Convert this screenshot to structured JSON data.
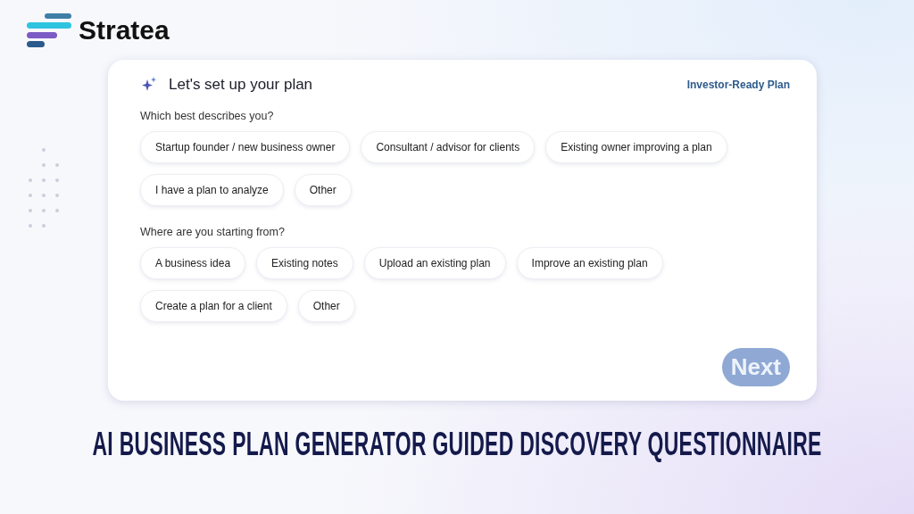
{
  "brand": {
    "name": "Stratea"
  },
  "card": {
    "title": "Let's set up your plan",
    "badge": "Investor-Ready Plan",
    "questions": [
      {
        "label": "Which best describes you?",
        "options": [
          {
            "label": "Startup founder / new business owner",
            "selected": false
          },
          {
            "label": "Consultant / advisor for clients",
            "selected": false
          },
          {
            "label": "Existing owner improving a plan",
            "selected": false
          },
          {
            "label": "I have a plan to analyze",
            "selected": false
          },
          {
            "label": "Other",
            "selected": false
          }
        ]
      },
      {
        "label": "Where are you starting from?",
        "options": [
          {
            "label": "A business idea",
            "selected": false
          },
          {
            "label": "Existing notes",
            "selected": false
          },
          {
            "label": "Upload an existing plan",
            "selected": false
          },
          {
            "label": "Improve an existing plan",
            "selected": false
          },
          {
            "label": "Create a plan for a client",
            "selected": false
          },
          {
            "label": "Other",
            "selected": false
          }
        ]
      }
    ],
    "next": {
      "label": "Next",
      "disabled": true
    }
  },
  "headline": "AI BUSINESS PLAN GENERATOR GUIDED DISCOVERY QUESTIONNAIRE"
}
